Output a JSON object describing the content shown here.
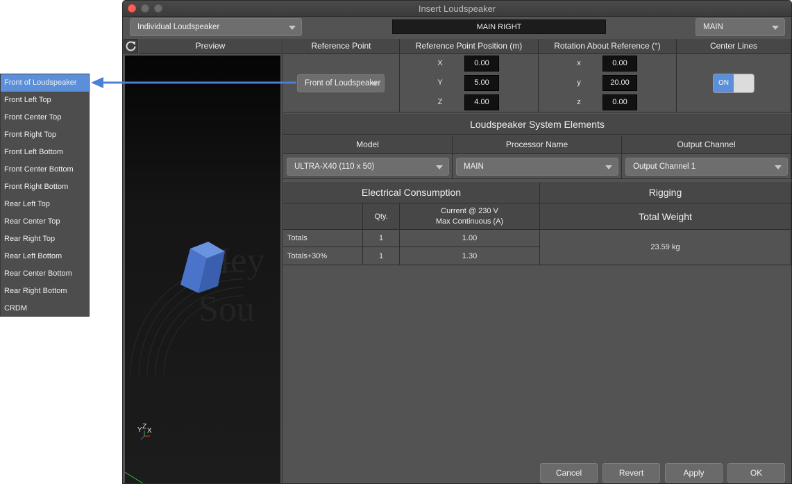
{
  "window": {
    "title": "Insert Loudspeaker"
  },
  "toolbar": {
    "mode": "Individual Loudspeaker",
    "name": "MAIN RIGHT",
    "group": "MAIN"
  },
  "preview": {
    "title": "Preview",
    "watermark_top": "Mey",
    "watermark_bottom": "Sou",
    "axis_y": "Y",
    "axis_z": "Z",
    "axis_x": "X"
  },
  "reference": {
    "header_point": "Reference Point",
    "header_position": "Reference Point Position (m)",
    "header_rotation": "Rotation About Reference (°)",
    "header_center": "Center Lines",
    "point_value": "Front of Loudspeaker",
    "position": [
      {
        "axis": "X",
        "value": "0.00"
      },
      {
        "axis": "Y",
        "value": "5.00"
      },
      {
        "axis": "Z",
        "value": "4.00"
      }
    ],
    "rotation": [
      {
        "axis": "x",
        "value": "0.00"
      },
      {
        "axis": "y",
        "value": "20.00"
      },
      {
        "axis": "z",
        "value": "0.00"
      }
    ],
    "center_lines_state": "ON"
  },
  "elements": {
    "title": "Loudspeaker System Elements",
    "col_model": "Model",
    "col_processor": "Processor Name",
    "col_output": "Output Channel",
    "model": "ULTRA-X40 (110 x 50)",
    "processor": "MAIN",
    "output": "Output Channel 1"
  },
  "consumption": {
    "title": "Electrical Consumption",
    "col_qty": "Qty.",
    "col_current_1": "Current @ 230 V",
    "col_current_2": "Max Continuous (A)",
    "rows": [
      {
        "label": "Totals",
        "qty": "1",
        "current": "1.00"
      },
      {
        "label": "Totals+30%",
        "qty": "1",
        "current": "1.30"
      }
    ]
  },
  "rigging": {
    "title": "Rigging",
    "col_weight": "Total Weight",
    "total_weight": "23.59 kg"
  },
  "buttons": {
    "cancel": "Cancel",
    "revert": "Revert",
    "apply": "Apply",
    "ok": "OK"
  },
  "reference_menu": {
    "items": [
      "Front of Loudspeaker",
      "Front Left Top",
      "Front Center Top",
      "Front Right Top",
      "Front Left Bottom",
      "Front Center Bottom",
      "Front Right Bottom",
      "Rear Left Top",
      "Rear Center Top",
      "Rear Right Top",
      "Rear Left Bottom",
      "Rear Center Bottom",
      "Rear Right Bottom",
      "CRDM"
    ],
    "selected_index": 0
  },
  "colors": {
    "accent": "#5b8fd9",
    "window_bg": "#535353",
    "header_bg": "#474747",
    "close": "#fc5f57",
    "minimize": "#6c6c6c",
    "zoom": "#6c6c6c",
    "speaker": "#4a74c9"
  }
}
